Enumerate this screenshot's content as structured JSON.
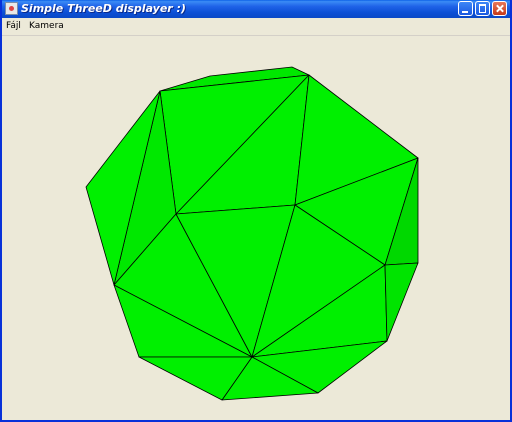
{
  "window": {
    "title": "Simple ThreeD displayer :)"
  },
  "menu": {
    "items": [
      "Fájl",
      "Kamera"
    ]
  },
  "scene": {
    "object": "polyhedron",
    "face_color": "#00f000",
    "edge_color": "#000000"
  }
}
